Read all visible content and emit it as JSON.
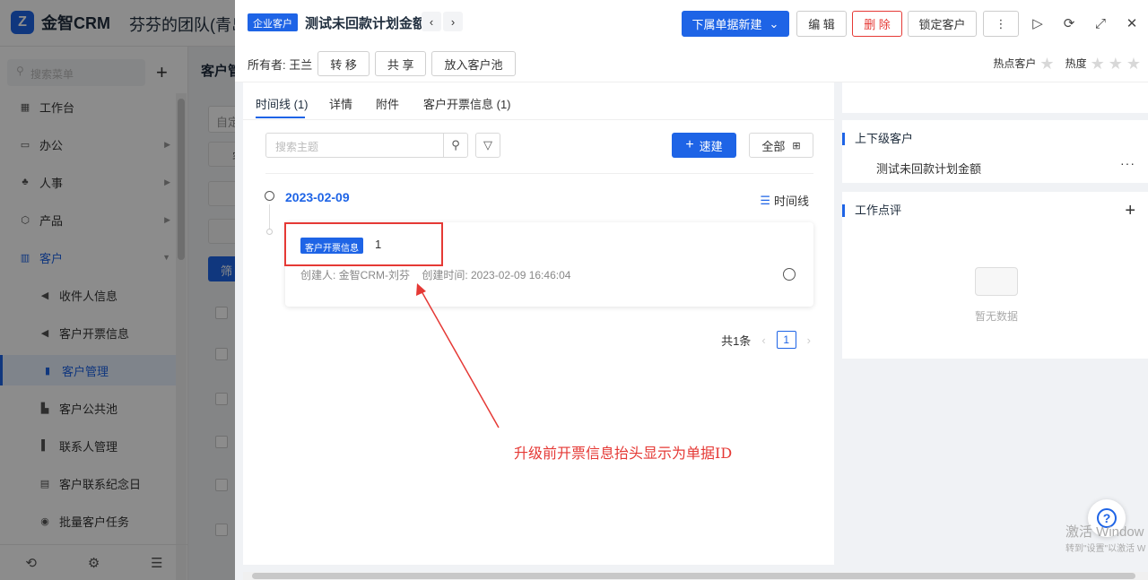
{
  "app": {
    "logo_text": "金智CRM",
    "team_name": "芬芬的团队(青岛"
  },
  "sidebar": {
    "search_placeholder": "搜索菜单",
    "items": [
      {
        "label": "工作台",
        "icon": "dashboard-icon"
      },
      {
        "label": "办公",
        "icon": "office-icon"
      },
      {
        "label": "人事",
        "icon": "people-icon"
      },
      {
        "label": "产品",
        "icon": "product-icon"
      },
      {
        "label": "客户",
        "icon": "customer-icon"
      }
    ],
    "subitems": [
      {
        "label": "收件人信息"
      },
      {
        "label": "客户开票信息"
      },
      {
        "label": "客户管理"
      },
      {
        "label": "客户公共池"
      },
      {
        "label": "联系人管理"
      },
      {
        "label": "客户联系纪念日"
      },
      {
        "label": "批量客户任务"
      }
    ]
  },
  "background": {
    "page_title": "客户管",
    "input_fragment": "自定",
    "tag_fragment": "客",
    "filter_btn": "筛"
  },
  "drawer": {
    "type_tag": "企业客户",
    "title": "测试未回款计划金额",
    "buttons": {
      "new_sub": "下属单据新建",
      "edit": "编 辑",
      "delete": "删 除",
      "lock": "锁定客户"
    },
    "owner_label": "所有者: 王兰",
    "owner_buttons": [
      "转 移",
      "共 享",
      "放入客户池"
    ],
    "hot_customer": "热点客户",
    "hotness": "热度",
    "tabs": [
      "时间线 (1)",
      "详情",
      "附件",
      "客户开票信息 (1)"
    ],
    "search_placeholder": "搜索主题",
    "quick_create": "速建",
    "all_label": "全部",
    "timeline": {
      "date": "2023-02-09",
      "view_label": "时间线",
      "entry": {
        "tag": "客户开票信息",
        "value": "1",
        "meta": "创建人: 金智CRM-刘芬    创建时间: 2023-02-09 16:46:04"
      }
    },
    "pager": {
      "total": "共1条",
      "current": "1"
    },
    "right": {
      "parent_title": "上下级客户",
      "parent_item": "测试未回款计划金额",
      "review_title": "工作点评",
      "empty_text": "暂无数据"
    }
  },
  "annotation": {
    "text": "升级前开票信息抬头显示为单据ID",
    "color": "#e53935"
  },
  "os_watermark": {
    "line1": "激活 Window",
    "line2": "转到\"设置\"以激活 W"
  },
  "colors": {
    "primary": "#1e64e6",
    "danger": "#e53935"
  }
}
